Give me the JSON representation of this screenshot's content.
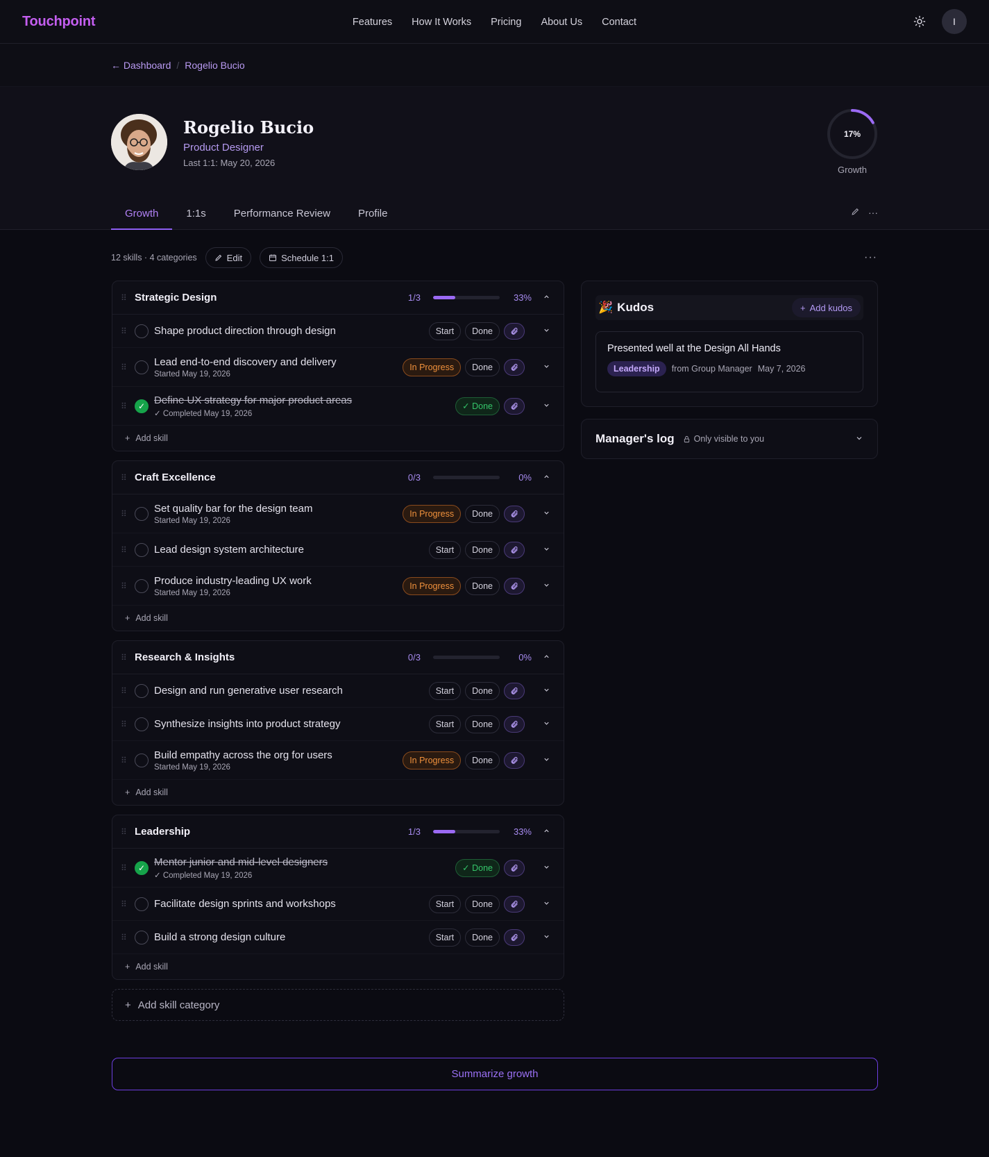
{
  "nav": {
    "brand": "Touchpoint",
    "links": [
      "Features",
      "How It Works",
      "Pricing",
      "About Us",
      "Contact"
    ],
    "avatar_initial": "I",
    "theme_icon": "sun-icon"
  },
  "breadcrumb": {
    "back": "← Dashboard",
    "current": "Rogelio Bucio"
  },
  "profile": {
    "name": "Rogelio Bucio",
    "role": "Product Designer",
    "last_one_on_one": "Last 1:1: May 20, 2026",
    "growth_pct": 17,
    "growth_pct_label": "17%",
    "growth_label": "Growth"
  },
  "tabs": [
    "Growth",
    "1:1s",
    "Performance Review",
    "Profile"
  ],
  "toolbar": {
    "summary": "12 skills · 4 categories",
    "edit": "Edit",
    "schedule": "Schedule 1:1"
  },
  "labels": {
    "start": "Start",
    "done": "Done",
    "in_progress": "In Progress",
    "done_check": "✓ Done",
    "add_skill": "Add skill",
    "add_category": "Add skill category"
  },
  "categories": [
    {
      "title": "Strategic Design",
      "count": "1/3",
      "pct": "33%",
      "fraction": 0.33,
      "skills": [
        {
          "title": "Shape product direction through design",
          "status": "start",
          "sub": ""
        },
        {
          "title": "Lead end-to-end discovery and delivery",
          "status": "progress",
          "sub": "Started May 19, 2026"
        },
        {
          "title": "Define UX strategy for major product areas",
          "status": "done",
          "sub": "✓ Completed May 19, 2026"
        }
      ]
    },
    {
      "title": "Craft Excellence",
      "count": "0/3",
      "pct": "0%",
      "fraction": 0,
      "skills": [
        {
          "title": "Set quality bar for the design team",
          "status": "progress",
          "sub": "Started May 19, 2026"
        },
        {
          "title": "Lead design system architecture",
          "status": "start",
          "sub": ""
        },
        {
          "title": "Produce industry-leading UX work",
          "status": "progress",
          "sub": "Started May 19, 2026"
        }
      ]
    },
    {
      "title": "Research & Insights",
      "count": "0/3",
      "pct": "0%",
      "fraction": 0,
      "skills": [
        {
          "title": "Design and run generative user research",
          "status": "start",
          "sub": ""
        },
        {
          "title": "Synthesize insights into product strategy",
          "status": "start",
          "sub": ""
        },
        {
          "title": "Build empathy across the org for users",
          "status": "progress",
          "sub": "Started May 19, 2026"
        }
      ]
    },
    {
      "title": "Leadership",
      "count": "1/3",
      "pct": "33%",
      "fraction": 0.33,
      "skills": [
        {
          "title": "Mentor junior and mid-level designers",
          "status": "done",
          "sub": "✓ Completed May 19, 2026"
        },
        {
          "title": "Facilitate design sprints and workshops",
          "status": "start",
          "sub": ""
        },
        {
          "title": "Build a strong design culture",
          "status": "start",
          "sub": ""
        }
      ]
    }
  ],
  "kudos": {
    "title": "Kudos",
    "add": "Add kudos",
    "item": {
      "title": "Presented well at the Design All Hands",
      "tag": "Leadership",
      "from": "from Group Manager",
      "date": "May 7, 2026"
    }
  },
  "managers_log": {
    "title": "Manager's log",
    "note": "Only visible to you"
  },
  "summarize": "Summarize growth",
  "colors": {
    "accent": "#8d5ef2",
    "brand": "#c45ef0",
    "progress": "#f0913c",
    "done": "#16a34a"
  }
}
